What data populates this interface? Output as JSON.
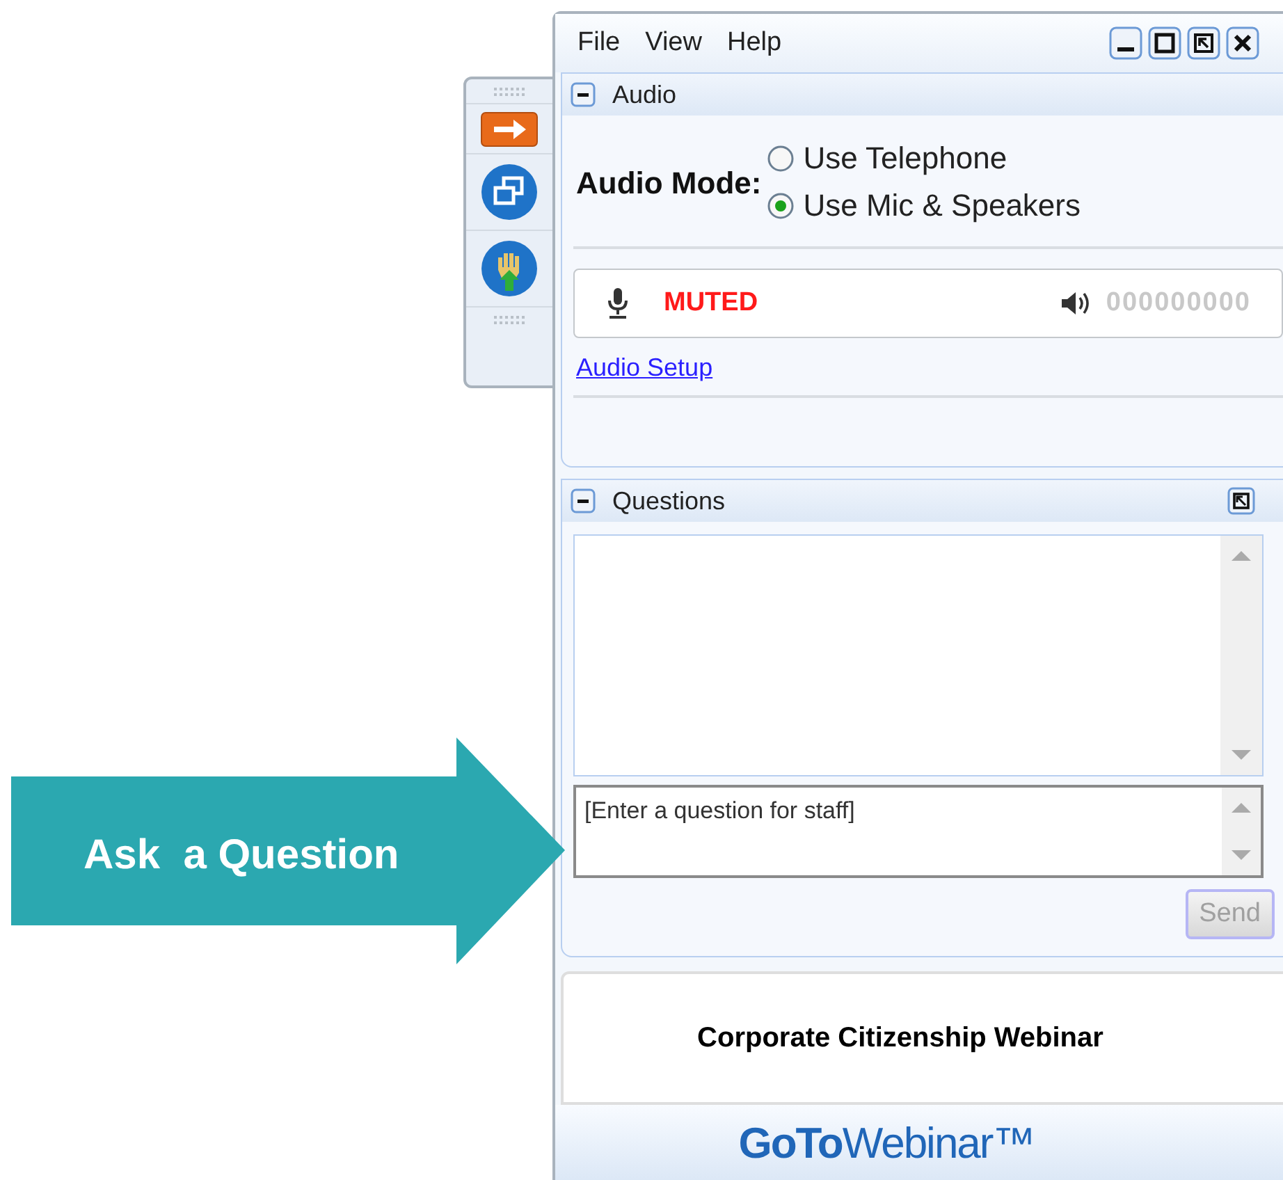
{
  "menu": [
    {
      "label": "File"
    },
    {
      "label": "View"
    },
    {
      "label": "Help"
    }
  ],
  "audio": {
    "title": "Audio",
    "expanded": true,
    "mode_label": "Audio Mode:",
    "options": [
      {
        "label": "Use Telephone",
        "selected": false
      },
      {
        "label": "Use Mic & Speakers",
        "selected": true
      }
    ],
    "mic_status": "MUTED",
    "speaker_reading": "000000000",
    "setup_link": "Audio Setup"
  },
  "questions": {
    "title": "Questions",
    "expanded": true,
    "input": {
      "placeholder": "[Enter a question for staff]"
    },
    "send": {
      "label": "Send",
      "disabled": true
    }
  },
  "webinar_title": "Corporate Citizenship Webinar",
  "logo": "**GoTo**Webinar™",
  "callout": {
    "label": "Ask  a Question"
  }
}
